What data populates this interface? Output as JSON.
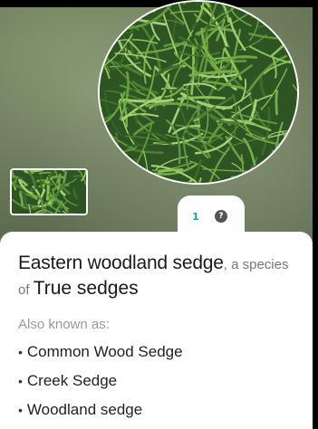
{
  "hero": {
    "main_photo_icon": "grass-photo",
    "thumbnail_icon": "grass-photo-thumbnail"
  },
  "pager": {
    "current_page": "1",
    "help_icon": "question-icon",
    "help_label": "?"
  },
  "plant": {
    "common_name": "Eastern woodland sedge",
    "species_suffix": ", a species",
    "of_label": "of ",
    "group_name": "True sedges"
  },
  "aka": {
    "heading": "Also known as:",
    "names": [
      "Common Wood Sedge",
      "Creek Sedge",
      "Woodland sedge"
    ],
    "bullet": "•"
  },
  "colors": {
    "accent": "#1aa0a0",
    "title": "#1a1a1a",
    "muted": "#777777"
  }
}
